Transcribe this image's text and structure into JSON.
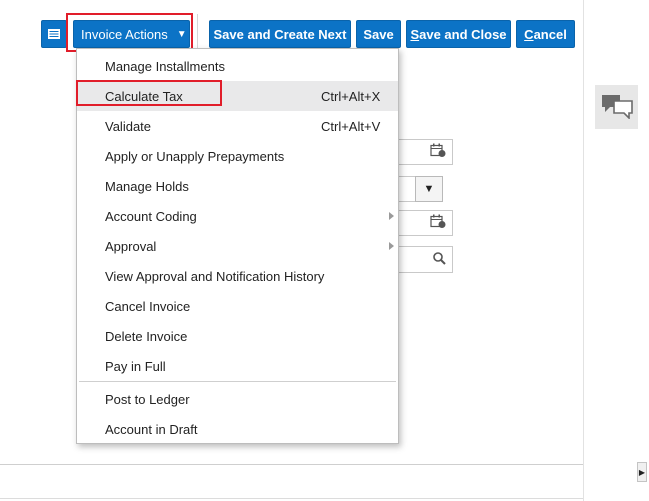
{
  "toolbar": {
    "list_icon": "list-icon",
    "invoice_actions_label": "Invoice Actions",
    "save_create_next_label": "Save and Create Next",
    "save_label": "Save",
    "save_close_label_accel": "S",
    "save_close_label_rest": "ave and Close",
    "cancel_label_accel": "C",
    "cancel_label_rest": "ancel"
  },
  "menu": {
    "items": [
      {
        "label": "Manage Installments",
        "shortcut": "",
        "submenu": false
      },
      {
        "label": "Calculate Tax",
        "shortcut": "Ctrl+Alt+X",
        "submenu": false
      },
      {
        "label": "Validate",
        "shortcut": "Ctrl+Alt+V",
        "submenu": false
      },
      {
        "label": "Apply or Unapply Prepayments",
        "shortcut": "",
        "submenu": false
      },
      {
        "label": "Manage Holds",
        "shortcut": "",
        "submenu": false
      },
      {
        "label": "Account Coding",
        "shortcut": "",
        "submenu": true
      },
      {
        "label": "Approval",
        "shortcut": "",
        "submenu": true
      },
      {
        "label": "View Approval and Notification History",
        "shortcut": "",
        "submenu": false
      },
      {
        "label": "Cancel Invoice",
        "shortcut": "",
        "submenu": false
      },
      {
        "label": "Delete Invoice",
        "shortcut": "",
        "submenu": false
      },
      {
        "label": "Pay in Full",
        "shortcut": "",
        "submenu": false
      },
      {
        "label": "Post to Ledger",
        "shortcut": "",
        "submenu": false
      },
      {
        "label": "Account in Draft",
        "shortcut": "",
        "submenu": false
      }
    ],
    "highlighted_item": "Calculate Tax"
  },
  "colors": {
    "button_blue": "#0c73c6",
    "highlight_red": "#e11d2a",
    "menu_hover": "#e9e9ea"
  },
  "icons": [
    "list-icon",
    "chevron-down-icon",
    "calendar-icon",
    "search-icon",
    "chat-icon",
    "submenu-arrow-icon"
  ]
}
